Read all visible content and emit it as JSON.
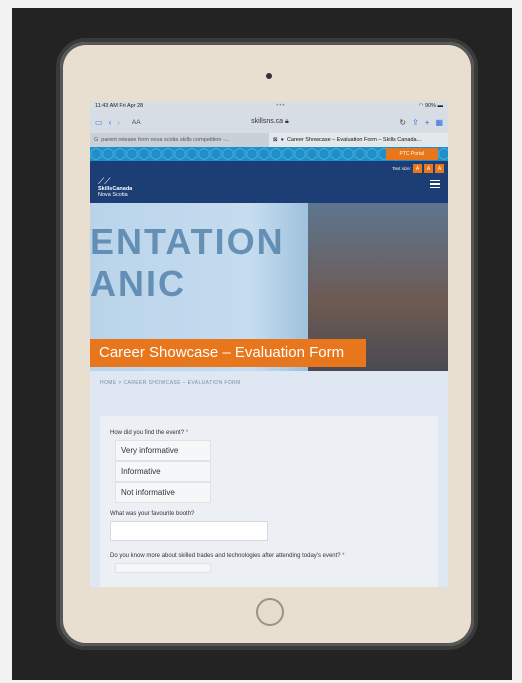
{
  "statusbar": {
    "time": "11:43 AM  Fri Apr 28",
    "battery": "90%"
  },
  "browser": {
    "aa_label": "AA",
    "url": "skillsns.ca",
    "tabs": [
      {
        "label": "parent release form nova scotia skills competition -..."
      },
      {
        "label": "Career Showcase – Evaluation Form – Skills Canada..."
      }
    ]
  },
  "site": {
    "ptc_portal": "PTC Portal",
    "text_size_label": "Text size:",
    "text_sizes": [
      "A",
      "A",
      "A"
    ],
    "logo_line1": "SkillsCanada",
    "logo_line2": "Nova Scotia"
  },
  "hero": {
    "background_text_line1": "ENTATION",
    "background_text_line2": "ANIC",
    "title": "Career Showcase – Evaluation Form"
  },
  "breadcrumb": "HOME > CAREER SHOWCASE – EVALUATION FORM",
  "form": {
    "q1": {
      "label": "How did you find the event?",
      "required_mark": "*",
      "options": [
        "Very informative",
        "Informative",
        "Not informative"
      ]
    },
    "q2": {
      "label": "What was your favourite booth?",
      "value": ""
    },
    "q3": {
      "label": "Do you know more about skilled trades and technologies after attending today's event?",
      "required_mark": "*"
    }
  },
  "colors": {
    "accent_orange": "#e8761d",
    "navy": "#1d3d75",
    "pattern_blue": "#1f8fc9",
    "ios_blue": "#2d6de0"
  }
}
